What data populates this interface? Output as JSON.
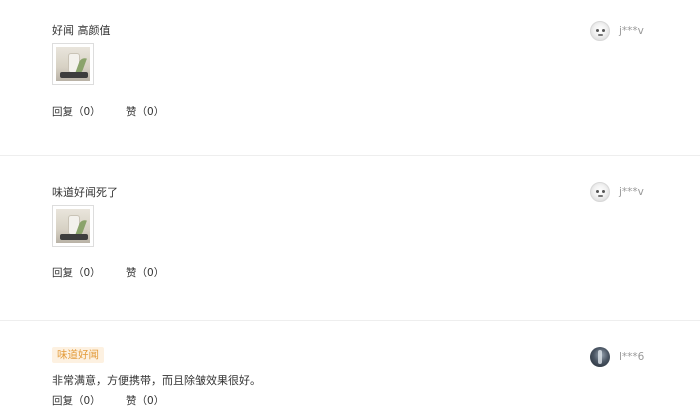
{
  "reviews": [
    {
      "text": "好闻 高颜值",
      "user": {
        "name": "j***v",
        "avatar": "light-avatar-icon"
      },
      "actions": {
        "reply": "回复（0）",
        "like": "赞（0）"
      }
    },
    {
      "text": "味道好闻死了",
      "user": {
        "name": "j***v",
        "avatar": "light-avatar-icon"
      },
      "actions": {
        "reply": "回复（0）",
        "like": "赞（0）"
      }
    },
    {
      "tag": "味道好闻",
      "text": "非常满意，方便携带，而且除皱效果很好。",
      "user": {
        "name": "l***6",
        "avatar": "dark-avatar-icon"
      },
      "actions": {
        "reply": "回复（0）",
        "like": "赞（0）"
      }
    }
  ],
  "colors": {
    "tag_bg": "#fdf1e1",
    "tag_text": "#e39b3a",
    "username": "#999999",
    "divider": "#eeeeee"
  }
}
